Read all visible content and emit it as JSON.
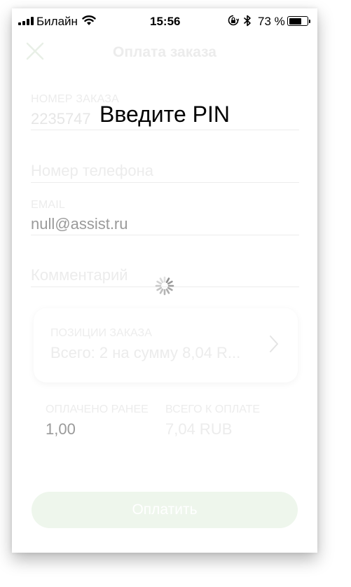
{
  "status_bar": {
    "carrier": "Билайн",
    "time": "15:56",
    "battery_percent": "73 %",
    "battery_level": 0.73,
    "icons": [
      "signal-icon",
      "wifi-icon",
      "rotation-lock-icon",
      "bluetooth-icon",
      "battery-icon"
    ]
  },
  "header": {
    "title": "Оплата заказа",
    "close_icon": "close-icon"
  },
  "form": {
    "order_number": {
      "label": "НОМЕР ЗАКАЗА",
      "value": "2235747"
    },
    "phone": {
      "placeholder": "Номер телефона"
    },
    "email": {
      "label": "EMAIL",
      "value": "null@assist.ru"
    },
    "comment": {
      "placeholder": "Комментарий"
    }
  },
  "order_items": {
    "label": "ПОЗИЦИИ ЗАКАЗА",
    "value": "Всего: 2 на сумму 8,04 R...",
    "icon": "chevron-right-icon"
  },
  "summary": {
    "paid_label": "ОПЛАЧЕНО РАНЕЕ",
    "paid_value": "1,00",
    "total_label": "ВСЕГО К ОПЛАТЕ",
    "total_value": "7,04 RUB"
  },
  "pay_button": {
    "label": "Оплатить"
  },
  "overlay": {
    "prompt": "Введите PIN",
    "spinner_icon": "spinner-icon"
  },
  "colors": {
    "accent_button": "#eef6ec",
    "faded_text": "#ececec"
  }
}
